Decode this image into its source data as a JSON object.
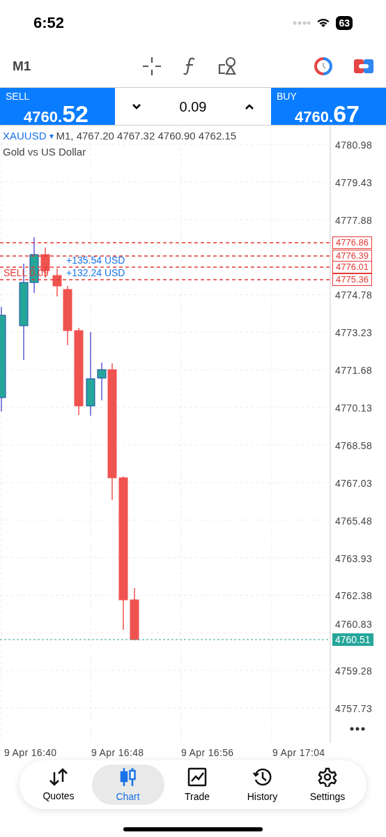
{
  "status_bar": {
    "time": "6:52",
    "battery": "63"
  },
  "toolbar": {
    "timeframe": "M1"
  },
  "quote_bar": {
    "sell": {
      "label": "SELL",
      "price_main": "4760.",
      "price_big": "52"
    },
    "volume": "0.09",
    "buy": {
      "label": "BUY",
      "price_main": "4760.",
      "price_big": "67"
    }
  },
  "chart": {
    "symbol": "XAUUSD",
    "caret": "▾",
    "ohlc": "M1, 4767.20 4767.32 4760.90 4762.15",
    "description": "Gold vs US Dollar",
    "price_axis": [
      "4780.98",
      "4779.43",
      "4777.88",
      "4774.78",
      "4773.23",
      "4771.68",
      "4770.13",
      "4768.58",
      "4767.03",
      "4765.48",
      "4763.93",
      "4762.38",
      "4760.83",
      "4759.28",
      "4757.73"
    ],
    "orders": [
      {
        "price": "4776.86"
      },
      {
        "price": "4776.39"
      },
      {
        "profit": "+135.54 USD",
        "price": "4776.01"
      },
      {
        "label": "SELL 0.09",
        "profit": "+132.24 USD",
        "price": "4775.36"
      }
    ],
    "current_price": "4760.51",
    "time_axis": [
      "9 Apr 16:40",
      "9 Apr 16:48",
      "9 Apr 16:56",
      "9 Apr 17:04"
    ]
  },
  "tabs": [
    {
      "label": "Quotes",
      "selected": false,
      "kind": "quotes"
    },
    {
      "label": "Chart",
      "selected": true,
      "kind": "chart"
    },
    {
      "label": "Trade",
      "selected": false,
      "kind": "trade"
    },
    {
      "label": "History",
      "selected": false,
      "kind": "history"
    },
    {
      "label": "Settings",
      "selected": false,
      "kind": "settings"
    }
  ]
}
